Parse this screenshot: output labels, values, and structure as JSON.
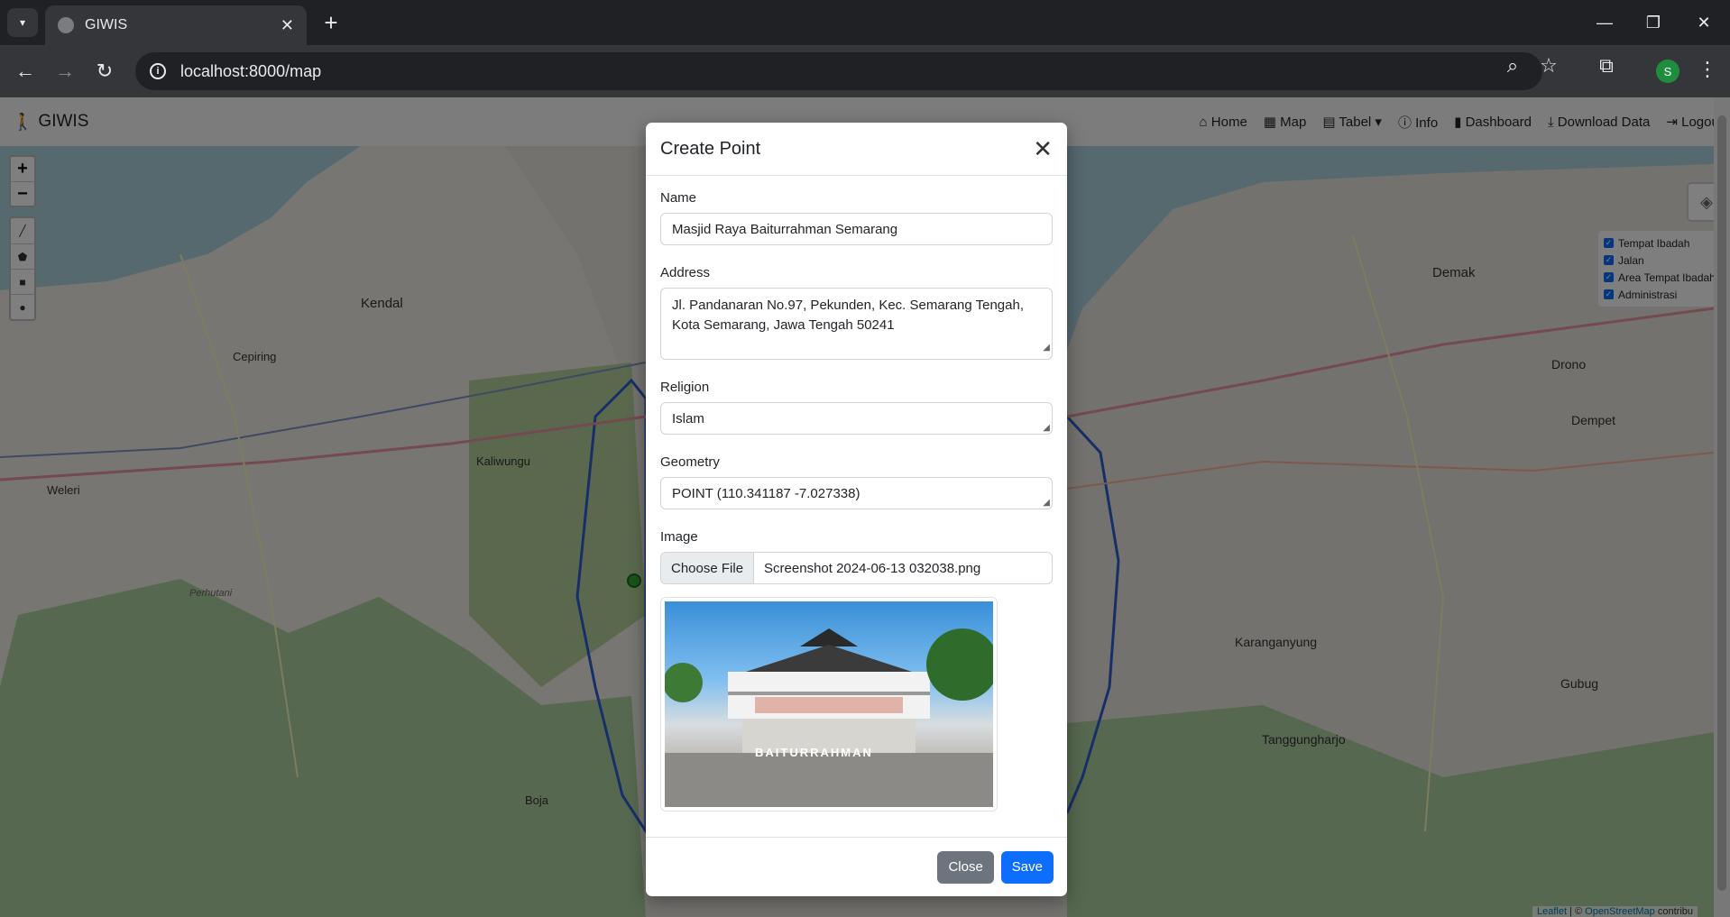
{
  "browser": {
    "tab_title": "GIWIS",
    "url": "localhost:8000/map",
    "profile_initial": "S"
  },
  "navbar": {
    "brand": "GIWIS",
    "links": {
      "home": "Home",
      "map": "Map",
      "tabel": "Tabel",
      "info": "Info",
      "dashboard": "Dashboard",
      "download": "Download Data",
      "logout": "Logout"
    }
  },
  "map": {
    "layers": [
      "Tempat Ibadah",
      "Jalan",
      "Area Tempat Ibadah",
      "Administrasi"
    ],
    "place_labels": [
      "Kendal",
      "Cepiring",
      "Kaliwungu",
      "Weleri",
      "Boja",
      "Demak",
      "Drono",
      "Dempet",
      "Gubug",
      "Karanganyung",
      "Tanggungharjo",
      "Perhutani"
    ],
    "attribution_leaflet": "Leaflet",
    "attribution_osm": "OpenStreetMap",
    "attribution_rest": "contribu"
  },
  "modal": {
    "title": "Create Point",
    "name_label": "Name",
    "name_value": "Masjid Raya Baiturrahman Semarang",
    "address_label": "Address",
    "address_value": "Jl. Pandanaran No.97, Pekunden, Kec. Semarang Tengah, Kota Semarang, Jawa Tengah 50241",
    "religion_label": "Religion",
    "religion_value": "Islam",
    "geometry_label": "Geometry",
    "geometry_value": "POINT (110.341187 -7.027338)",
    "image_label": "Image",
    "choose_file": "Choose File",
    "file_name": "Screenshot 2024-06-13 032038.png",
    "photo_sign": "BAITURRAHMAN",
    "close": "Close",
    "save": "Save"
  },
  "colors": {
    "primary": "#0d6efd",
    "secondary": "#6c757d",
    "logout": "#dc3545"
  }
}
